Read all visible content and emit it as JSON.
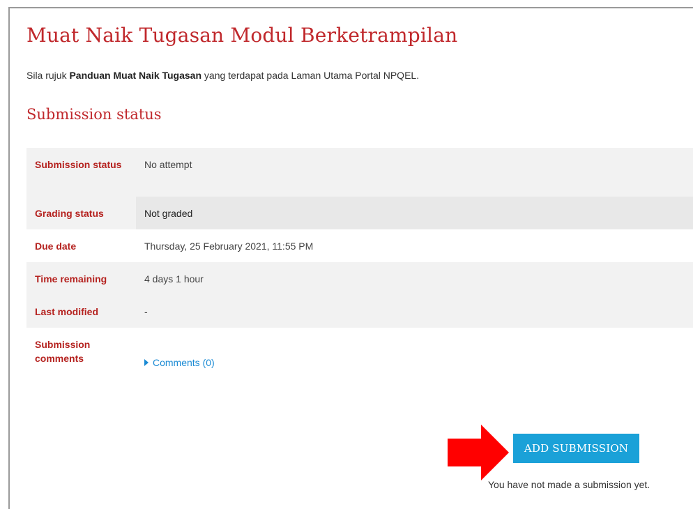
{
  "page": {
    "title": "Muat Naik Tugasan Modul Berketrampilan",
    "intro_prefix": "Sila rujuk ",
    "intro_bold": "Panduan Muat Naik Tugasan",
    "intro_suffix": " yang terdapat pada Laman Utama Portal NPQEL.",
    "section_title": "Submission status"
  },
  "status_rows": [
    {
      "label": "Submission status",
      "value": "No attempt"
    },
    {
      "label": "Grading status",
      "value": "Not graded"
    },
    {
      "label": "Due date",
      "value": "Thursday, 25 February 2021, 11:55 PM"
    },
    {
      "label": "Time remaining",
      "value": "4 days 1 hour"
    },
    {
      "label": "Last modified",
      "value": "-"
    },
    {
      "label": "Submission comments",
      "value": "Comments (0)"
    }
  ],
  "actions": {
    "add_submission_label": "ADD SUBMISSION",
    "note": "You have not made a submission yet."
  },
  "colors": {
    "accent_red": "#c0282c",
    "button_blue": "#1aa1d8",
    "link_blue": "#1a8ad4",
    "arrow_red": "#ff0000"
  }
}
